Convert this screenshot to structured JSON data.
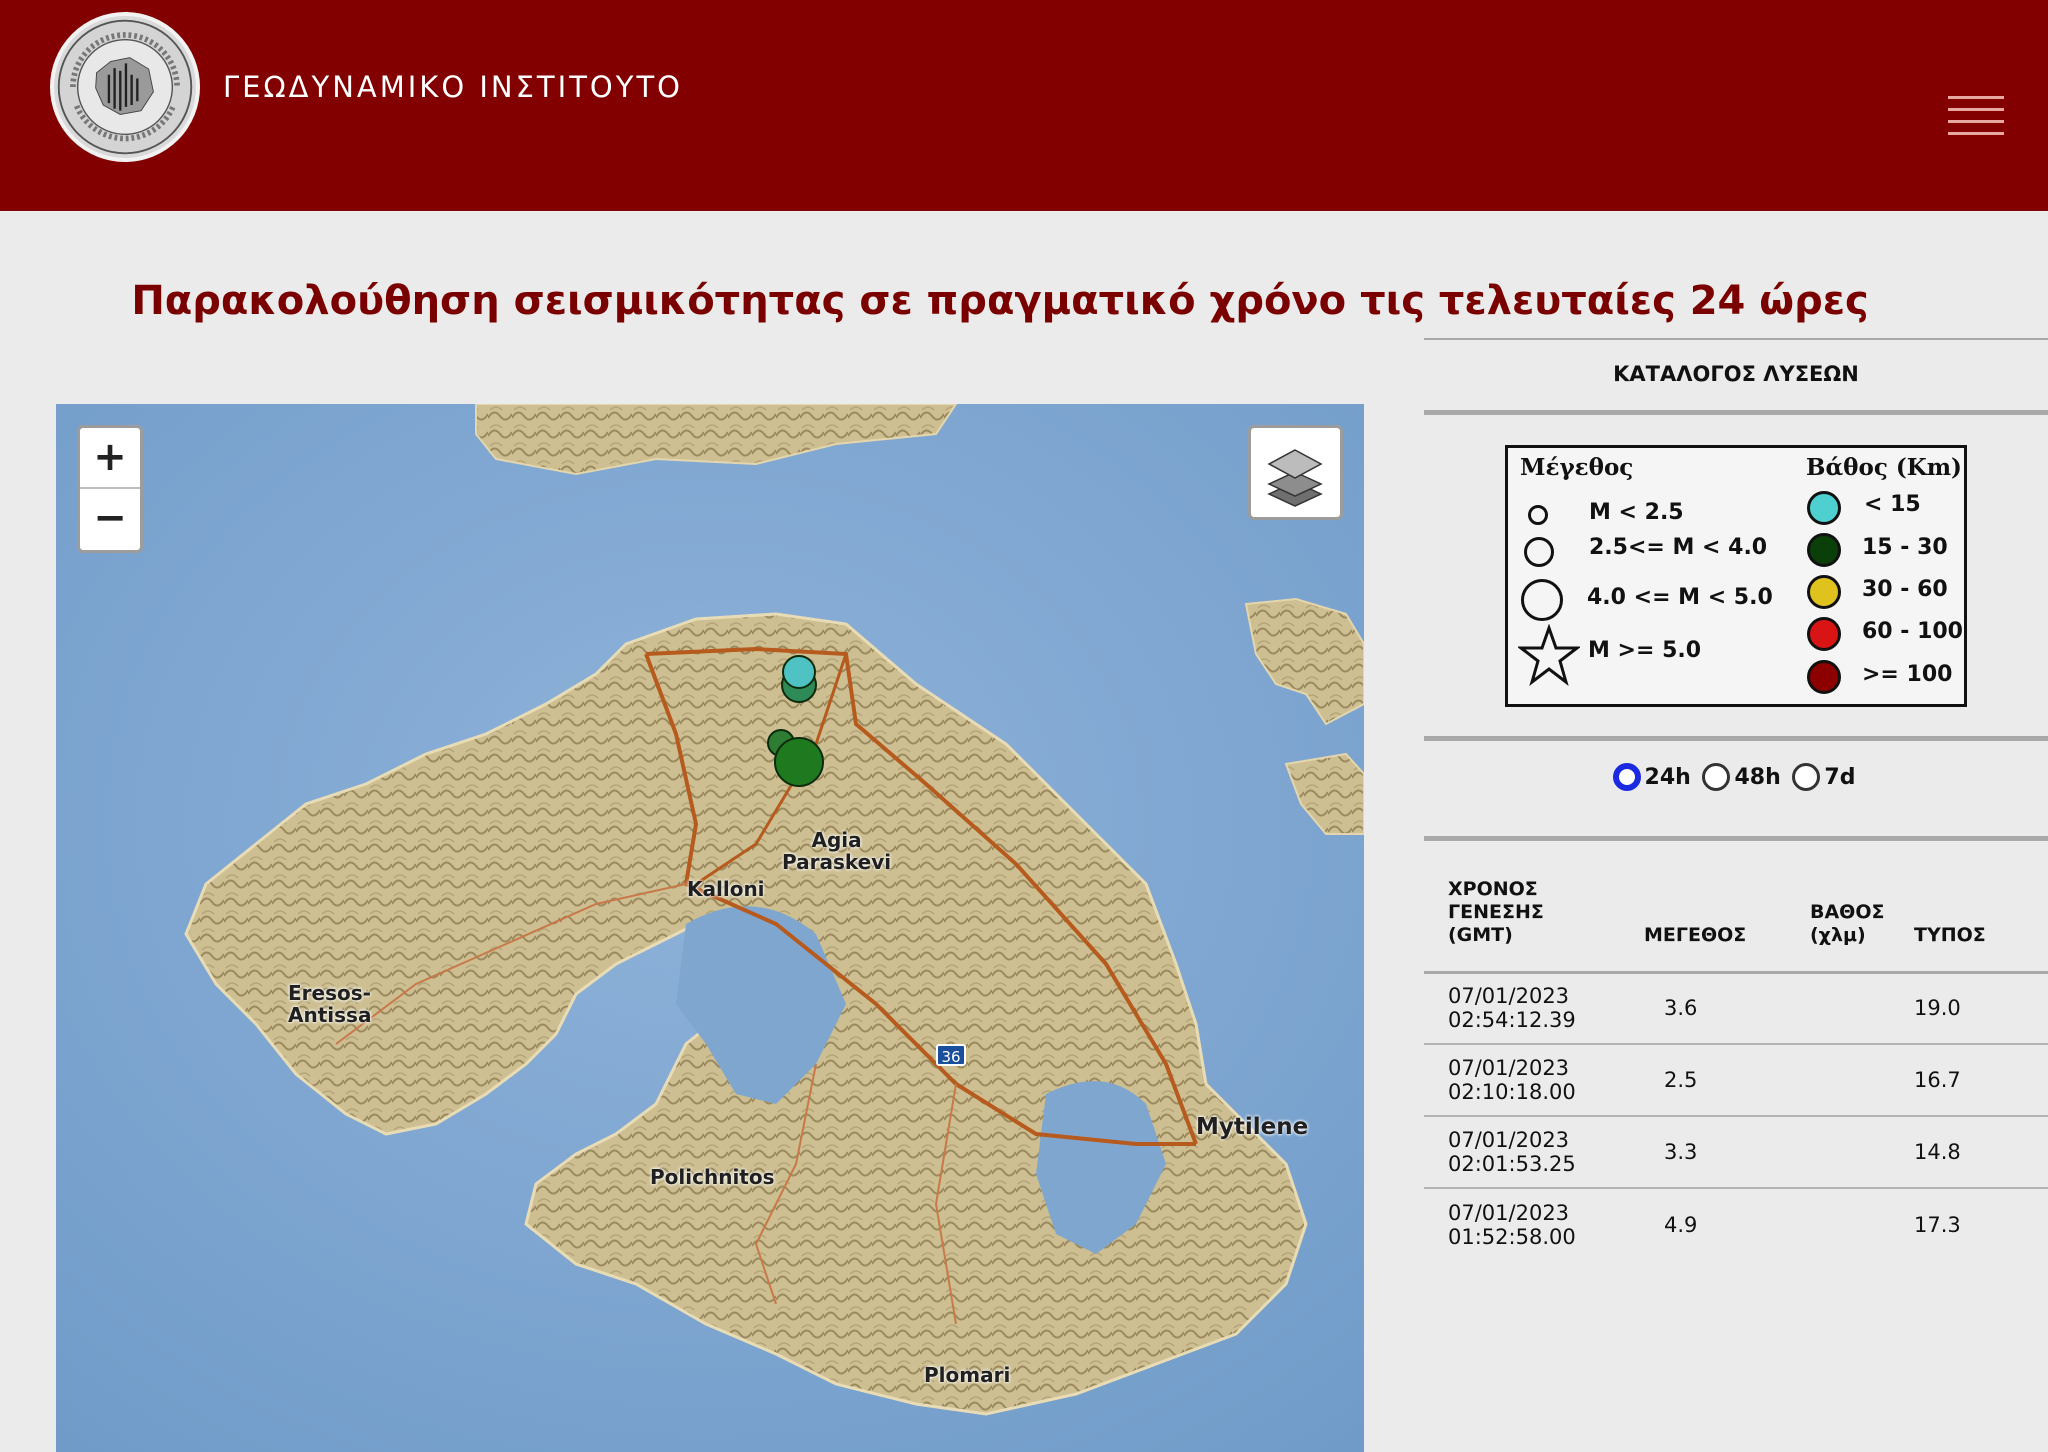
{
  "header": {
    "title": "ΓΕΩΔΥΝΑΜΙΚΟ ΙΝΣΤΙΤΟΥΤΟ",
    "logo_icon": "institute-seal-logo",
    "menu_icon": "hamburger-menu-icon",
    "background_color": "#820000"
  },
  "page": {
    "heading": "Παρακολούθηση σεισμικότητας σε πραγματικό χρόνο τις τελευταίες 24 ώρες"
  },
  "map": {
    "zoom_in_label": "+",
    "zoom_out_label": "−",
    "layers_icon": "layers-icon",
    "route_label": "36",
    "places": [
      {
        "name": "Agia\nParaskevi"
      },
      {
        "name": "Kalloni"
      },
      {
        "name": "Eresos-\nAntissa"
      },
      {
        "name": "Mytilene"
      },
      {
        "name": "Polichnitos"
      },
      {
        "name": "Plomari"
      }
    ]
  },
  "panel": {
    "catalog_title": "ΚΑΤΑΛΟΓΟΣ ΛΥΣΕΩΝ",
    "legend": {
      "magnitude_title": "Μέγεθος",
      "depth_title": "Βάθος (Km)",
      "magnitude_items": [
        "M < 2.5",
        "2.5<= M < 4.0",
        "4.0 <= M < 5.0",
        "M >= 5.0"
      ],
      "depth_items": [
        {
          "label": "< 15",
          "color": "#4fd0d0"
        },
        {
          "label": "15 - 30",
          "color": "#0a3f0a"
        },
        {
          "label": "30 - 60",
          "color": "#e0c21e"
        },
        {
          "label": "60 - 100",
          "color": "#d81414"
        },
        {
          "label": ">= 100",
          "color": "#8c0000"
        }
      ]
    },
    "time_range": {
      "options": [
        "24h",
        "48h",
        "7d"
      ],
      "selected": "24h"
    },
    "table": {
      "headers": [
        "ΧΡΟΝΟΣ\nΓΕΝΕΣΗΣ\n(GMT)",
        "ΜΕΓΕΘΟΣ",
        "ΒΑΘΟΣ\n(χλμ)",
        "ΤΥΠΟΣ"
      ],
      "rows": [
        {
          "time": "07/01/2023 02:54:12.39",
          "magnitude": "3.6",
          "depth": "19.0"
        },
        {
          "time": "07/01/2023 02:10:18.00",
          "magnitude": "2.5",
          "depth": "16.7"
        },
        {
          "time": "07/01/2023 02:01:53.25",
          "magnitude": "3.3",
          "depth": "14.8"
        },
        {
          "time": "07/01/2023 01:52:58.00",
          "magnitude": "4.9",
          "depth": "17.3"
        }
      ]
    }
  }
}
